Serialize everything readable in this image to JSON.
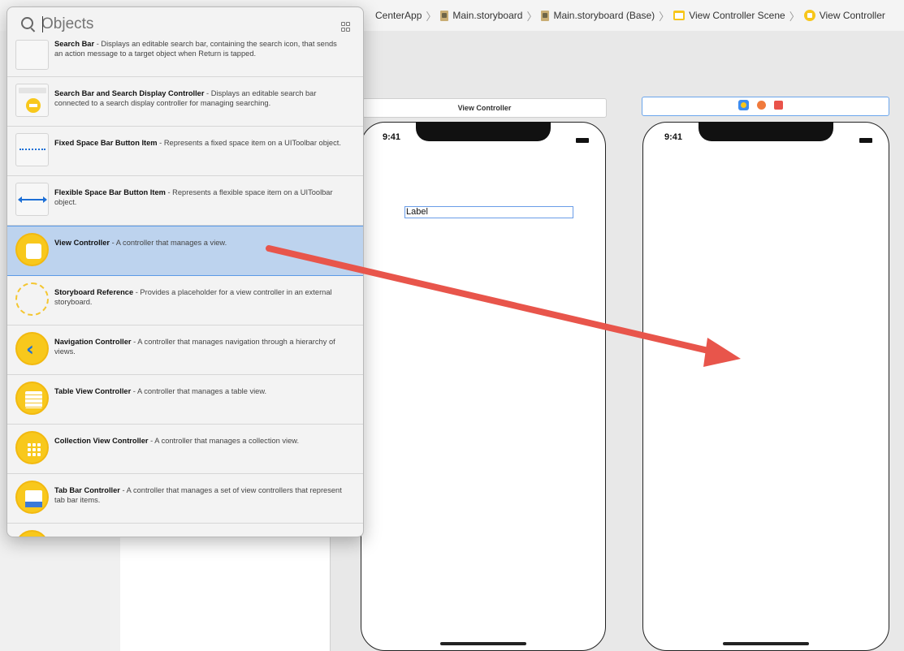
{
  "breadcrumb": {
    "items": [
      "CenterApp",
      "Main.storyboard",
      "Main.storyboard (Base)",
      "View Controller Scene",
      "View Controller"
    ]
  },
  "library": {
    "search_placeholder": "Objects",
    "items": [
      {
        "title": "Search Bar",
        "desc": " - Displays an editable search bar, containing the search icon, that sends an action message to a target object when Return is tapped.",
        "icon": "search-bar-icon"
      },
      {
        "title": "Search Bar and Search Display Controller",
        "desc": " - Displays an editable search bar connected to a search display controller for managing searching.",
        "icon": "search-display-controller-icon"
      },
      {
        "title": "Fixed Space Bar Button Item",
        "desc": " - Represents a fixed space item on a UIToolbar object.",
        "icon": "fixed-space-icon"
      },
      {
        "title": "Flexible Space Bar Button Item",
        "desc": " - Represents a flexible space item on a UIToolbar object.",
        "icon": "flexible-space-icon"
      },
      {
        "title": "View Controller",
        "desc": " - A controller that manages a view.",
        "icon": "view-controller-icon",
        "selected": true
      },
      {
        "title": "Storyboard Reference",
        "desc": " - Provides a placeholder for a view controller in an external storyboard.",
        "icon": "storyboard-reference-icon"
      },
      {
        "title": "Navigation Controller",
        "desc": " - A controller that manages navigation through a hierarchy of views.",
        "icon": "navigation-controller-icon"
      },
      {
        "title": "Table View Controller",
        "desc": " - A controller that manages a table view.",
        "icon": "table-view-controller-icon"
      },
      {
        "title": "Collection View Controller",
        "desc": " - A controller that manages a collection view.",
        "icon": "collection-view-controller-icon"
      },
      {
        "title": "Tab Bar Controller",
        "desc": " - A controller that manages a set of view controllers that represent tab bar items.",
        "icon": "tab-bar-controller-icon"
      }
    ]
  },
  "canvas": {
    "scene1_title": "View Controller",
    "phone1_time": "9:41",
    "phone1_label": "Label",
    "phone2_time": "9:41"
  },
  "colors": {
    "selection": "#bdd3ee",
    "accent_blue": "#5b9ae6",
    "icon_yellow": "#f8c81c",
    "drag_arrow": "#e8554b"
  }
}
